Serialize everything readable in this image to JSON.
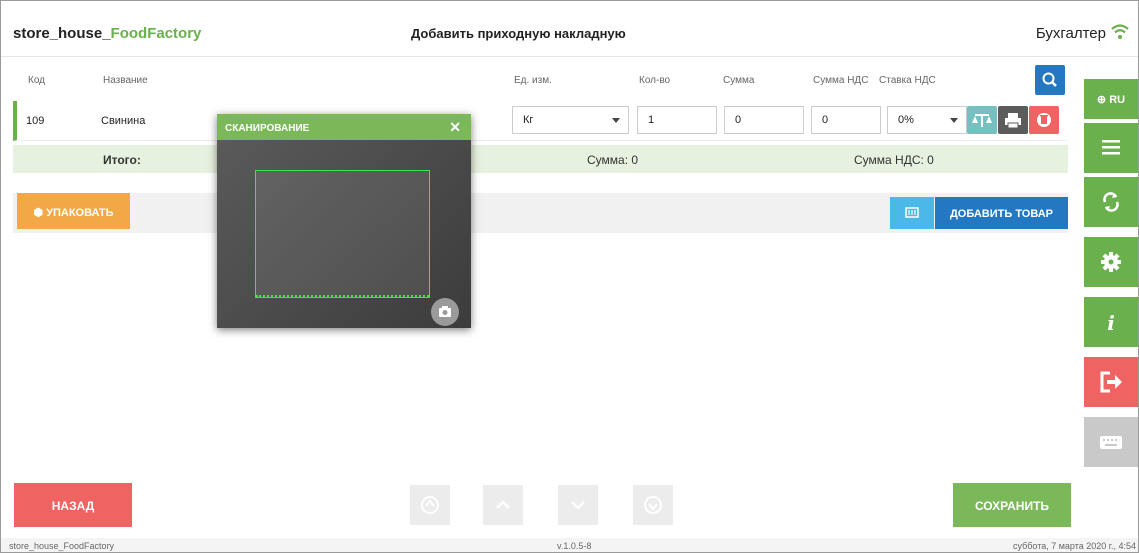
{
  "header": {
    "brand_prefix": "store_house_",
    "brand_accent": "FoodFactory",
    "title": "Добавить приходную накладную",
    "user": "Бухгалтер"
  },
  "table": {
    "columns": [
      "Код",
      "Название",
      "Ед. изм.",
      "Кол-во",
      "Сумма",
      "Сумма НДС",
      "Ставка НДС"
    ],
    "row": {
      "code": "109",
      "name": "Свинина",
      "unit": "Кг",
      "qty": "1",
      "sum": "0",
      "vat_sum": "0",
      "vat_rate": "0%"
    },
    "total": {
      "label": "Итого:",
      "sum": "Сумма: 0",
      "vat_sum": "Сумма НДС: 0"
    }
  },
  "actions": {
    "pack": "УПАКОВАТЬ",
    "add_item": "ДОБАВИТЬ ТОВАР"
  },
  "scan_modal": {
    "title": "СКАНИРОВАНИЕ",
    "close": "✕"
  },
  "sidebar": {
    "lang": "RU",
    "icons": [
      "menu-icon",
      "sync-icon",
      "gear-icon",
      "info-icon",
      "logout-icon",
      "keyboard-icon"
    ]
  },
  "footer": {
    "back": "НАЗАД",
    "save": "СОХРАНИТЬ",
    "app_name": "store_house_FoodFactory",
    "version": "v.1.0.5-8",
    "datetime": "суббота, 7 марта 2020 г., 4:54"
  },
  "colors": {
    "green": "#6ab04c",
    "blue": "#2478c2",
    "red": "#f06363",
    "orange": "#f3a848",
    "teal": "#76c0c0"
  }
}
